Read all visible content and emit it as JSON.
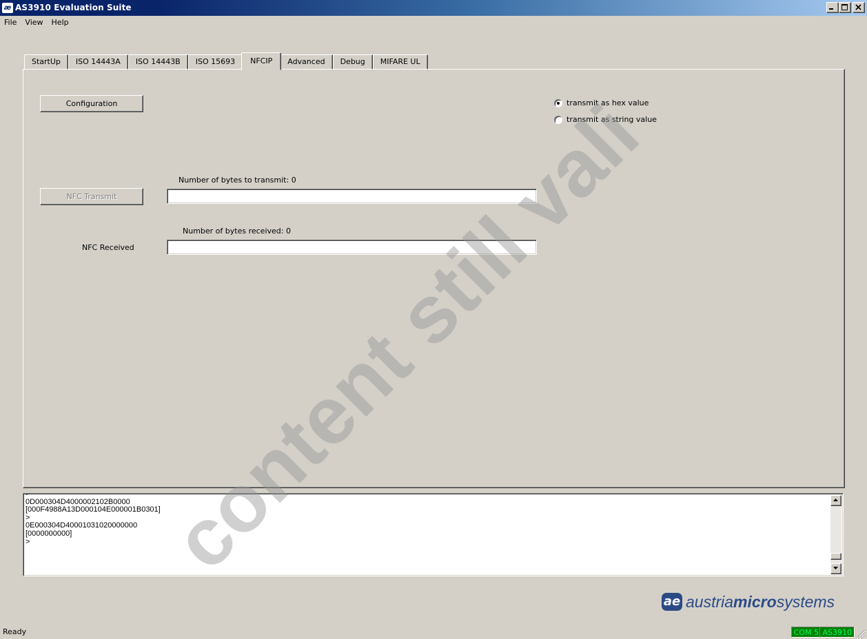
{
  "window": {
    "title": "AS3910 Evaluation Suite",
    "app_icon_glyph": "æ"
  },
  "menu": [
    "File",
    "View",
    "Help"
  ],
  "tabs": [
    {
      "label": "StartUp",
      "active": false
    },
    {
      "label": "ISO 14443A",
      "active": false
    },
    {
      "label": "ISO 14443B",
      "active": false
    },
    {
      "label": "ISO 15693",
      "active": false
    },
    {
      "label": "NFCIP",
      "active": true
    },
    {
      "label": "Advanced",
      "active": false
    },
    {
      "label": "Debug",
      "active": false
    },
    {
      "label": "MIFARE UL",
      "active": false
    }
  ],
  "nfcip": {
    "configuration_label": "Configuration",
    "transmit_button_label": "NFC Transmit",
    "transmit_count_label": "Number of bytes to transmit: 0",
    "transmit_value": "",
    "received_count_label": "Number of bytes received: 0",
    "received_label": "NFC Received",
    "received_value": "",
    "mode_options": [
      {
        "label": "transmit as hex value",
        "checked": true
      },
      {
        "label": "transmit as string value",
        "checked": false
      }
    ]
  },
  "log": {
    "lines": [
      ">",
      "0D000304D4000002102B0000",
      "[000F4988A13D000104E000001B0301]",
      ">",
      "0E000304D40001031020000000",
      "[0000000000]",
      ">"
    ]
  },
  "logo": {
    "mark": "ae",
    "text_plain_1": "austria",
    "text_bold": "micro",
    "text_plain_2": "systems",
    "color": "#2b4a86"
  },
  "status": {
    "text": "Ready",
    "port": "COM 5",
    "device": "AS3910",
    "panel_bg": "#008000",
    "panel_fg": "#00ff66"
  },
  "watermark": "content still vali"
}
